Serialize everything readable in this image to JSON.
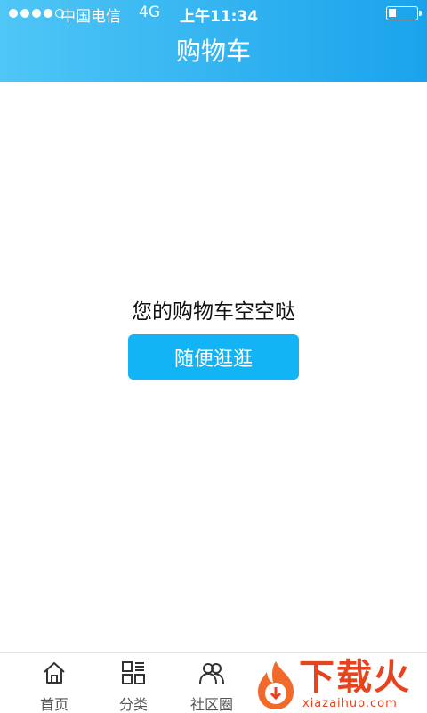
{
  "status_bar": {
    "carrier": "中国电信",
    "network": "4G",
    "time": "上午11:34"
  },
  "header": {
    "title": "购物车"
  },
  "empty_state": {
    "message": "您的购物车空空哒",
    "button_label": "随便逛逛"
  },
  "tab_bar": {
    "items": [
      {
        "label": "首页",
        "icon": "home-icon"
      },
      {
        "label": "分类",
        "icon": "category-grid-icon"
      },
      {
        "label": "社区圈",
        "icon": "community-icon"
      }
    ]
  },
  "watermark": {
    "text": "下载火",
    "url": "xiazaihuo.com"
  },
  "colors": {
    "header_start": "#4fc6f6",
    "header_end": "#1aa3ec",
    "button": "#12b4f6",
    "watermark": "#e8431f"
  }
}
